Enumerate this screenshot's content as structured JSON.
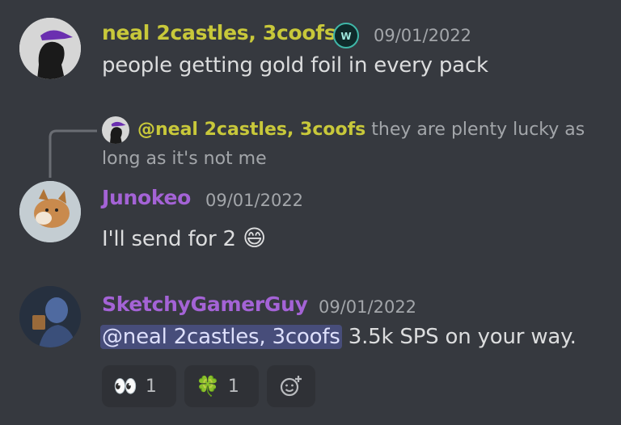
{
  "colors": {
    "background": "#36393f",
    "username_yellow": "#c8c83a",
    "username_purple": "#a463d6",
    "timestamp": "#a3a6aa",
    "mention_bg": "#474d7a"
  },
  "messages": [
    {
      "username": "neal 2castles, 3coofs",
      "timestamp": "09/01/2022",
      "text": "people getting gold foil in every pack",
      "badge_icon": "server-badge-icon"
    },
    {
      "reply": {
        "username": "@neal 2castles, 3coofs",
        "text_line1": "they are plenty lucky as",
        "text_line2": "long as it's not me"
      },
      "username": "Junokeo",
      "timestamp": "09/01/2022",
      "text": "I'll send for 2",
      "emoji": "😄"
    },
    {
      "username": "SketchyGamerGuy",
      "timestamp": "09/01/2022",
      "mention": "@neal 2castles, 3coofs",
      "text": " 3.5k SPS on your way.",
      "reactions": [
        {
          "emoji": "👀",
          "count": "1",
          "icon": "eyes-emoji-icon"
        },
        {
          "emoji": "🍀",
          "count": "1",
          "icon": "four-leaf-clover-emoji-icon"
        }
      ],
      "add_reaction_icon": "add-reaction-icon"
    }
  ]
}
